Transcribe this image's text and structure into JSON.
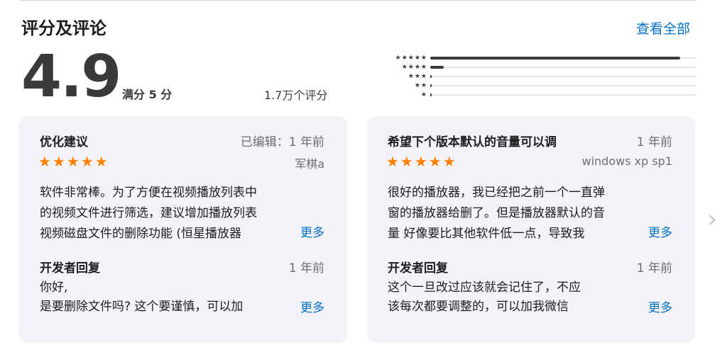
{
  "section": {
    "title": "评分及评论",
    "see_all": "查看全部"
  },
  "summary": {
    "score": "4.9",
    "out_of": "满分 5 分",
    "count": "1.7万个评分"
  },
  "histogram": [
    {
      "stars": "★★★★★",
      "fraction": 0.94
    },
    {
      "stars": "★★★★",
      "fraction": 0.05
    },
    {
      "stars": "★★★",
      "fraction": 0.005
    },
    {
      "stars": "★★",
      "fraction": 0.003
    },
    {
      "stars": "★",
      "fraction": 0.003
    }
  ],
  "reviews": [
    {
      "title": "优化建议",
      "date": "已编辑：1 年前",
      "author": "军棋a",
      "stars": "★★★★★",
      "rating": 5,
      "body_lines": [
        "软件非常棒。为了方便在视频播放列表中",
        "的视频文件进行筛选，建议增加播放列表",
        "视频磁盘文件的删除功能 (恒星播放器"
      ],
      "more": "更多",
      "dev_label": "开发者回复",
      "dev_date": "1 年前",
      "dev_lines": [
        "你好,",
        "是要删除文件吗? 这个要谨慎，可以加"
      ],
      "dev_more": "更多"
    },
    {
      "title": "希望下个版本默认的音量可以调",
      "date": "1 年前",
      "author": "windows xp sp1",
      "stars": "★★★★★",
      "rating": 5,
      "body_lines": [
        "很好的播放器，我已经把之前一个一直弹",
        "窗的播放器给删了。但是播放器默认的音",
        "量 好像要比其他软件低一点，导致我"
      ],
      "more": "更多",
      "dev_label": "开发者回复",
      "dev_date": "1 年前",
      "dev_lines": [
        "这个一旦改过应该就会记住了，不应",
        "该每次都要调整的，可以加我微信"
      ],
      "dev_more": "更多"
    }
  ],
  "nav": {
    "next": "›",
    "prev": "‹"
  }
}
